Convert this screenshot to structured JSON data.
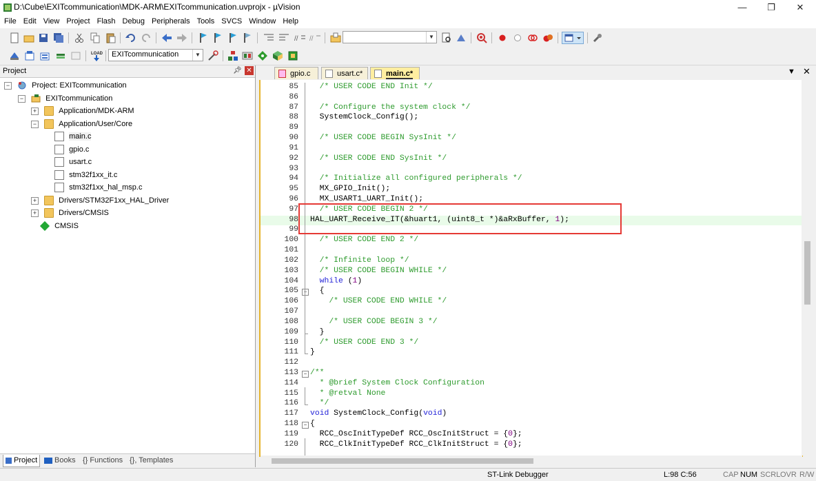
{
  "window": {
    "title": "D:\\Cube\\EXITcommunication\\MDK-ARM\\EXITcommunication.uvprojx - µVision",
    "minimize": "—",
    "maximize": "❐",
    "close": "✕"
  },
  "menu": [
    "File",
    "Edit",
    "View",
    "Project",
    "Flash",
    "Debug",
    "Peripherals",
    "Tools",
    "SVCS",
    "Window",
    "Help"
  ],
  "toolbar": {
    "target_combo": "EXITcommunication"
  },
  "project_panel": {
    "title": "Project",
    "tree": [
      {
        "label": "Project: EXITcommunication",
        "expander": "⊟",
        "icon": "project-icon"
      },
      {
        "label": "EXITcommunication",
        "expander": "⊟",
        "icon": "target-folder-icon"
      },
      {
        "label": "Application/MDK-ARM",
        "expander": "+",
        "icon": "folder-icon"
      },
      {
        "label": "Application/User/Core",
        "expander": "−",
        "icon": "folder-icon"
      },
      {
        "label": "main.c",
        "icon": "file-icon",
        "selected": true
      },
      {
        "label": "gpio.c",
        "icon": "file-icon"
      },
      {
        "label": "usart.c",
        "icon": "file-icon"
      },
      {
        "label": "stm32f1xx_it.c",
        "icon": "file-icon"
      },
      {
        "label": "stm32f1xx_hal_msp.c",
        "icon": "file-icon"
      },
      {
        "label": "Drivers/STM32F1xx_HAL_Driver",
        "expander": "+",
        "icon": "folder-icon"
      },
      {
        "label": "Drivers/CMSIS",
        "expander": "+",
        "icon": "folder-icon"
      },
      {
        "label": "CMSIS",
        "icon": "green-diamond-icon"
      }
    ],
    "bottom_tabs": [
      "Project",
      "Books",
      "{} Functions",
      "{}, Templates"
    ]
  },
  "editor": {
    "tabs": [
      {
        "label": "gpio.c",
        "active": false
      },
      {
        "label": "usart.c*",
        "active": false
      },
      {
        "label": "main.c*",
        "active": true
      }
    ],
    "lines": [
      {
        "n": "85",
        "code": "  /* USER CODE END Init */",
        "type": "cm"
      },
      {
        "n": "86",
        "code": "",
        "type": ""
      },
      {
        "n": "87",
        "code": "  /* Configure the system clock */",
        "type": "cm"
      },
      {
        "n": "88",
        "code": "  SystemClock_Config();",
        "type": ""
      },
      {
        "n": "89",
        "code": "",
        "type": ""
      },
      {
        "n": "90",
        "code": "  /* USER CODE BEGIN SysInit */",
        "type": "cm"
      },
      {
        "n": "91",
        "code": "",
        "type": ""
      },
      {
        "n": "92",
        "code": "  /* USER CODE END SysInit */",
        "type": "cm"
      },
      {
        "n": "93",
        "code": "",
        "type": ""
      },
      {
        "n": "94",
        "code": "  /* Initialize all configured peripherals */",
        "type": "cm"
      },
      {
        "n": "95",
        "code": "  MX_GPIO_Init();",
        "type": ""
      },
      {
        "n": "96",
        "code": "  MX_USART1_UART_Init();",
        "type": ""
      },
      {
        "n": "97",
        "code": "  /* USER CODE BEGIN 2 */",
        "type": "cm"
      },
      {
        "n": "98",
        "code": "HAL_UART_Receive_IT(&huart1, (uint8_t *)&aRxBuffer, 1);",
        "type": "hl"
      },
      {
        "n": "99",
        "code": "",
        "type": ""
      },
      {
        "n": "100",
        "code": "  /* USER CODE END 2 */",
        "type": "cm"
      },
      {
        "n": "101",
        "code": "",
        "type": ""
      },
      {
        "n": "102",
        "code": "  /* Infinite loop */",
        "type": "cm"
      },
      {
        "n": "103",
        "code": "  /* USER CODE BEGIN WHILE */",
        "type": "cm"
      },
      {
        "n": "104",
        "code": "  while (1)",
        "type": "kw"
      },
      {
        "n": "105",
        "code": "  {",
        "type": ""
      },
      {
        "n": "106",
        "code": "    /* USER CODE END WHILE */",
        "type": "cm"
      },
      {
        "n": "107",
        "code": "",
        "type": ""
      },
      {
        "n": "108",
        "code": "    /* USER CODE BEGIN 3 */",
        "type": "cm"
      },
      {
        "n": "109",
        "code": "  }",
        "type": ""
      },
      {
        "n": "110",
        "code": "  /* USER CODE END 3 */",
        "type": "cm"
      },
      {
        "n": "111",
        "code": "}",
        "type": ""
      },
      {
        "n": "112",
        "code": "",
        "type": ""
      },
      {
        "n": "113",
        "code": "/**",
        "type": "cm"
      },
      {
        "n": "114",
        "code": "  * @brief System Clock Configuration",
        "type": "cm"
      },
      {
        "n": "115",
        "code": "  * @retval None",
        "type": "cm"
      },
      {
        "n": "116",
        "code": "  */",
        "type": "cm"
      },
      {
        "n": "117",
        "code": "void SystemClock_Config(void)",
        "type": "kw2"
      },
      {
        "n": "118",
        "code": "{",
        "type": ""
      },
      {
        "n": "119",
        "code": "  RCC_OscInitTypeDef RCC_OscInitStruct = {0};",
        "type": "num"
      },
      {
        "n": "120",
        "code": "  RCC_ClkInitTypeDef RCC_ClkInitStruct = {0};",
        "type": "num"
      }
    ]
  },
  "statusbar": {
    "debugger": "ST-Link Debugger",
    "position": "L:98 C:56",
    "indicators": [
      "CAP",
      "NUM",
      "SCRL",
      "OVR",
      "R/W"
    ]
  },
  "colors": {
    "comment": "#2e9b2e",
    "keyword": "#2424d8",
    "number": "#800080",
    "highlight_box": "#e53935",
    "active_line": "#e9fbe9",
    "editor_border": "#e6b42c"
  }
}
